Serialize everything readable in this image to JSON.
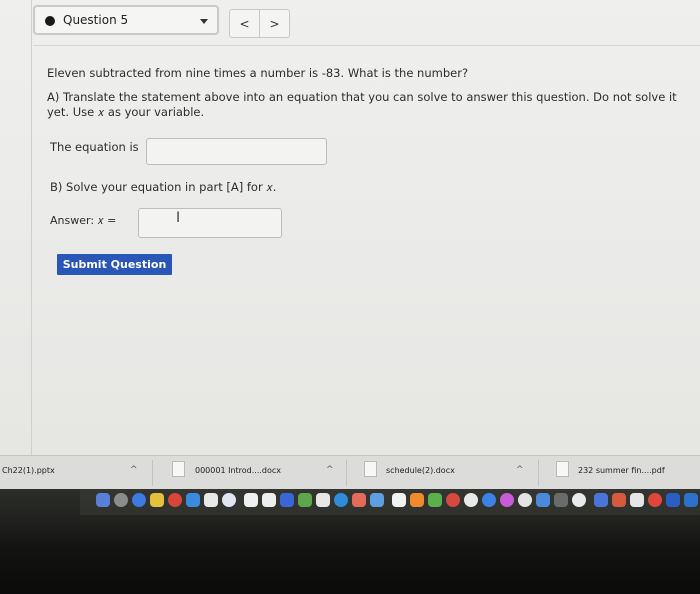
{
  "header": {
    "question_select": "Question 5",
    "prev_label": "<",
    "next_label": ">"
  },
  "question": {
    "text": "Eleven subtracted from nine times a number is -83. What is the number?",
    "part_a": "A) Translate the statement above into an equation that you can solve to answer this question. Do not solve it yet. Use 𝑥 as your variable.",
    "equation_label": "The equation is",
    "equation_value": "",
    "part_b": "B) Solve your equation in part [A] for 𝑥.",
    "answer_label": "Answer: 𝑥 =",
    "answer_value": "",
    "submit_label": "Submit Question"
  },
  "downloads": [
    {
      "name": "Ch22(1).pptx"
    },
    {
      "name": "000001 Introd....docx"
    },
    {
      "name": "schedule(2).docx"
    },
    {
      "name": "232 summer fin....pdf"
    }
  ],
  "colors": {
    "accent": "#2a56b8",
    "page_bg": "#ececea",
    "dock_bg": "#1a1a18"
  }
}
